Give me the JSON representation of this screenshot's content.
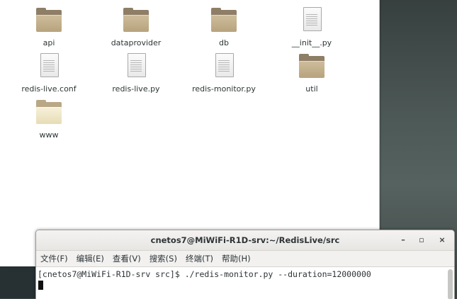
{
  "file_manager": {
    "items": [
      {
        "name": "api",
        "type": "folder"
      },
      {
        "name": "dataprovider",
        "type": "folder"
      },
      {
        "name": "db",
        "type": "folder"
      },
      {
        "name": "__init__.py",
        "type": "document"
      },
      {
        "name": "redis-live.conf",
        "type": "document"
      },
      {
        "name": "redis-live.py",
        "type": "document"
      },
      {
        "name": "redis-monitor.py",
        "type": "document"
      },
      {
        "name": "util",
        "type": "folder"
      },
      {
        "name": "www",
        "type": "folder"
      }
    ]
  },
  "terminal": {
    "title": "cnetos7@MiWiFi-R1D-srv:~/RedisLive/src",
    "window_buttons": {
      "minimize": "–",
      "maximize": "▫",
      "close": "×"
    },
    "menu": [
      "文件(F)",
      "编辑(E)",
      "查看(V)",
      "搜索(S)",
      "终端(T)",
      "帮助(H)"
    ],
    "prompt_line": "[cnetos7@MiWiFi-R1D-srv src]$ ./redis-monitor.py --duration=12000000"
  }
}
